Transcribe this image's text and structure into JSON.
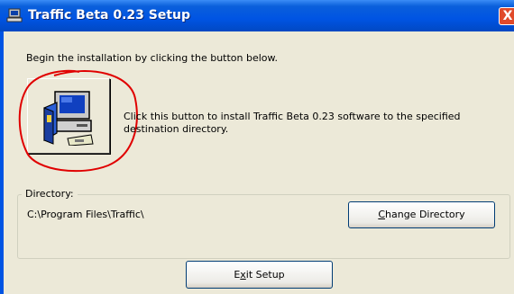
{
  "window": {
    "title": "Traffic Beta 0.23 Setup",
    "close_label": "X"
  },
  "intro_text": "Begin the installation by clicking the button below.",
  "install_description": "Click this button to install Traffic Beta 0.23 software to the specified destination directory.",
  "directory": {
    "group_label": "Directory:",
    "path": "C:\\Program Files\\Traffic\\",
    "change_button_prefix": "",
    "change_button_access_key": "C",
    "change_button_rest": "hange Directory"
  },
  "exit_button": {
    "prefix": "E",
    "access_key": "x",
    "rest": "it Setup"
  },
  "icons": {
    "app": "setup-computer-icon",
    "install": "install-computer-icon",
    "annotation": "red-circle-annotation"
  },
  "colors": {
    "titlebar": "#0054e3",
    "background": "#ece9d8",
    "close": "#e04a2a",
    "annotation": "#e00000"
  }
}
